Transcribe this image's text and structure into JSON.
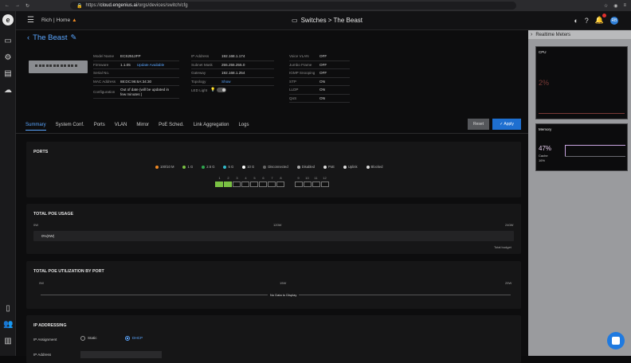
{
  "browser": {
    "url_prefix": "https://",
    "url_host": "cloud.engenius.ai",
    "url_path": "/orgs/devices/switch/cfg"
  },
  "header": {
    "breadcrumb_org": "Rich",
    "breadcrumb_home": "Home",
    "title_icon": "switch-icon",
    "title": "Switches > The Beast",
    "avatar_initials": "RB"
  },
  "device": {
    "name": "The Beast",
    "col1": [
      {
        "k": "Model Name",
        "v": "ECS2512FP",
        "link": ""
      },
      {
        "k": "Firmware",
        "v": "1.1.05",
        "link": "Update Available"
      },
      {
        "k": "Serial No.",
        "v": "",
        "link": ""
      },
      {
        "k": "MAC Address",
        "v": "88:DC:96:6A:34:30",
        "link": ""
      },
      {
        "k": "Configuration",
        "v": "Out of date (will be updated in few minutes )",
        "link": ""
      }
    ],
    "col2": [
      {
        "k": "IP Address",
        "v": "192.168.1.174"
      },
      {
        "k": "Subnet Mask",
        "v": "255.255.255.0"
      },
      {
        "k": "Gateway",
        "v": "192.168.1.254"
      },
      {
        "k": "Topology",
        "v": "Show"
      },
      {
        "k": "LED Light",
        "v": ""
      }
    ],
    "col3": [
      {
        "k": "Voice VLAN",
        "v": "OFF"
      },
      {
        "k": "Jumbo Frame",
        "v": "OFF"
      },
      {
        "k": "IGMP Snooping",
        "v": "OFF"
      },
      {
        "k": "STP",
        "v": "ON"
      },
      {
        "k": "LLDP",
        "v": "ON"
      },
      {
        "k": "QoS",
        "v": "ON"
      }
    ]
  },
  "tabs": [
    "Summary",
    "System Conf.",
    "Ports",
    "VLAN",
    "Mirror",
    "PoE Sched.",
    "Link Aggregation",
    "Logs"
  ],
  "actions": {
    "reset": "Reset",
    "apply": "Apply"
  },
  "ports": {
    "title": "PORTS",
    "legend": [
      {
        "label": "100/10 M",
        "color": "#f08a24"
      },
      {
        "label": "1 G",
        "color": "#7ac143"
      },
      {
        "label": "2.5 G",
        "color": "#2fa84f"
      },
      {
        "label": "5 G",
        "color": "#31b9c9"
      },
      {
        "label": "10 G",
        "color": "#ffffff"
      },
      {
        "label": "Disconnected",
        "color": "#666666"
      },
      {
        "label": "Disabled",
        "color": "#aaaaaa"
      },
      {
        "label": "PoE",
        "color": "#dddddd"
      },
      {
        "label": "Uplink",
        "color": "#dddddd"
      },
      {
        "label": "Blocked",
        "color": "#dddddd"
      }
    ],
    "numbers": [
      "1",
      "2",
      "3",
      "4",
      "5",
      "6",
      "7",
      "8",
      "",
      "9",
      "10",
      "11",
      "12"
    ]
  },
  "poe_usage": {
    "title": "TOTAL POE USAGE",
    "scale_min": "0W",
    "scale_mid": "120W",
    "scale_max": "240W",
    "bar_label": "0%(0W)",
    "footer": "Total budget"
  },
  "poe_by_port": {
    "title": "TOTAL POE UTILIZATION BY PORT",
    "scale_min": "0W",
    "scale_mid": "15W",
    "scale_max": "25W",
    "empty": "No Data to Display"
  },
  "ip": {
    "title": "IP ADDRESSING",
    "assignment_label": "IP Assignment",
    "opt_static": "Static",
    "opt_dhcp": "DHCP",
    "next_label": "IP Address"
  },
  "realtime": {
    "title": "Realtime Meters",
    "cpu_label": "CPU",
    "cpu_value": "2%",
    "mem_label": "Memory",
    "mem_value": "47%",
    "mem_sub1": "Cache",
    "mem_sub2": "16%"
  }
}
